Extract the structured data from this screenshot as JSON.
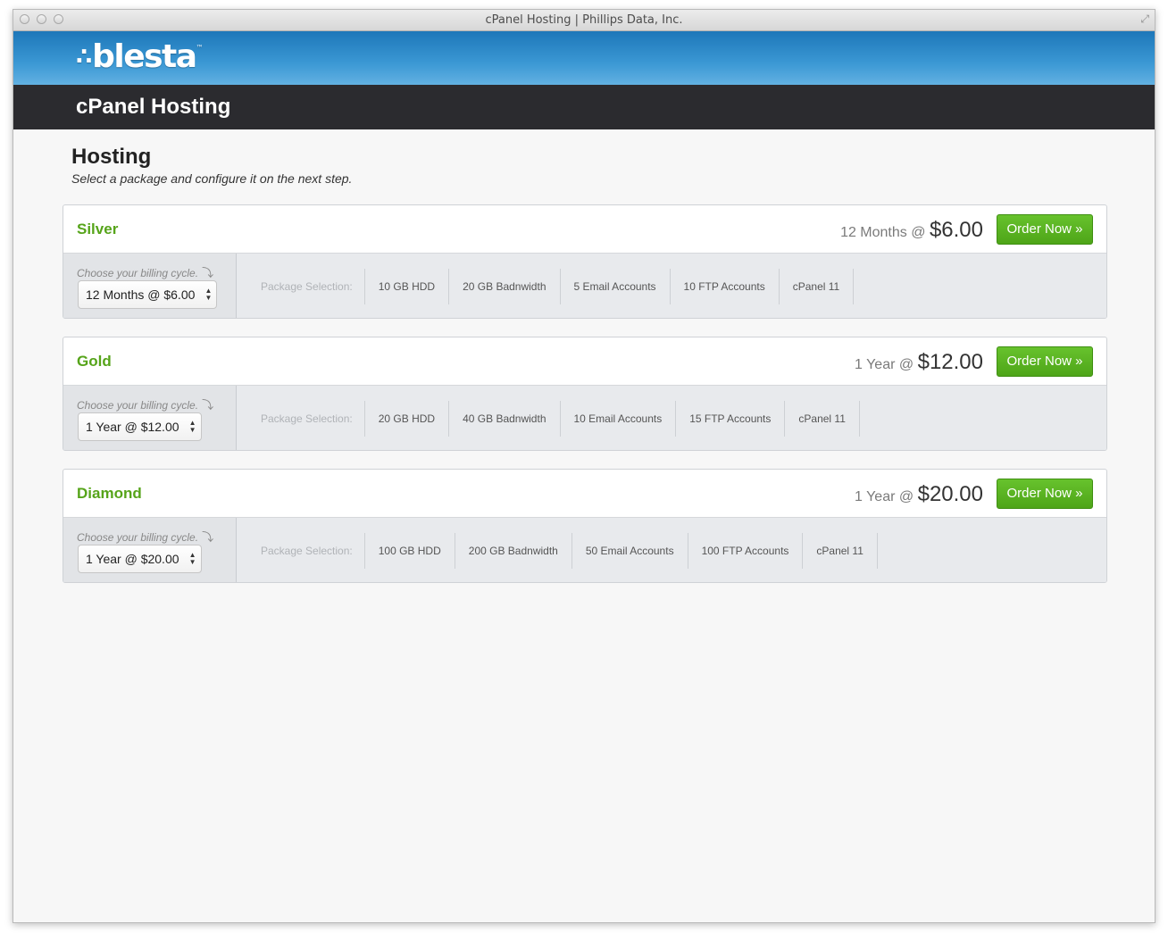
{
  "window": {
    "title": "cPanel Hosting | Phillips Data, Inc."
  },
  "brand": {
    "logo_text": "blesta",
    "logo_mark": "™"
  },
  "header": {
    "title": "cPanel Hosting"
  },
  "page": {
    "heading": "Hosting",
    "subheading": "Select a package and configure it on the next step."
  },
  "colors": {
    "accent_green": "#56a41a",
    "brand_blue": "#2b8ccb",
    "dark_bar": "#2b2b2f"
  },
  "packages": [
    {
      "name": "Silver",
      "price_term": "12 Months",
      "price_at": "@",
      "price_amount": "$6.00",
      "order_label": "Order Now »",
      "cycle_label": "Choose your billing cycle.",
      "cycle_value": "12 Months @ $6.00",
      "selection_label": "Package Selection:",
      "features": [
        "10 GB HDD",
        "20 GB Badnwidth",
        "5 Email Accounts",
        "10 FTP Accounts",
        "cPanel 11"
      ]
    },
    {
      "name": "Gold",
      "price_term": "1 Year",
      "price_at": "@",
      "price_amount": "$12.00",
      "order_label": "Order Now »",
      "cycle_label": "Choose your billing cycle.",
      "cycle_value": "1 Year @ $12.00",
      "selection_label": "Package Selection:",
      "features": [
        "20 GB HDD",
        "40 GB Badnwidth",
        "10 Email Accounts",
        "15 FTP Accounts",
        "cPanel 11"
      ]
    },
    {
      "name": "Diamond",
      "price_term": "1 Year",
      "price_at": "@",
      "price_amount": "$20.00",
      "order_label": "Order Now »",
      "cycle_label": "Choose your billing cycle.",
      "cycle_value": "1 Year @ $20.00",
      "selection_label": "Package Selection:",
      "features": [
        "100 GB HDD",
        "200 GB Badnwidth",
        "50 Email Accounts",
        "100 FTP Accounts",
        "cPanel 11"
      ]
    }
  ]
}
